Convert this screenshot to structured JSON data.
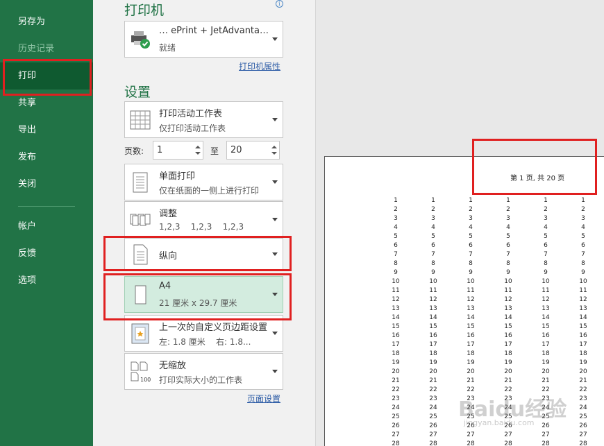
{
  "sidebar": {
    "items": [
      {
        "label": "另存为"
      },
      {
        "label": "历史记录"
      },
      {
        "label": "打印"
      },
      {
        "label": "共享"
      },
      {
        "label": "导出"
      },
      {
        "label": "发布"
      },
      {
        "label": "关闭"
      },
      {
        "label": "帐户"
      },
      {
        "label": "反馈"
      },
      {
        "label": "选项"
      }
    ]
  },
  "printer": {
    "section_title": "打印机",
    "name": "…  ePrint + JetAdvanta…",
    "status": "就绪",
    "properties_link": "打印机属性"
  },
  "settings": {
    "section_title": "设置",
    "print_what": {
      "title": "打印活动工作表",
      "subtitle": "仅打印活动工作表"
    },
    "pages_label": "页数:",
    "page_from": "1",
    "to_label": "至",
    "page_to": "20",
    "sides": {
      "title": "单面打印",
      "subtitle": "仅在纸面的一侧上进行打印"
    },
    "collation": {
      "title": "调整",
      "subtitle": "1,2,3    1,2,3    1,2,3"
    },
    "orientation": {
      "title": "纵向"
    },
    "paper": {
      "title": "A4",
      "subtitle": "21 厘米 x 29.7 厘米"
    },
    "margins": {
      "title": "上一次的自定义页边距设置",
      "subtitle": "左: 1.8 厘米    右: 1.8..."
    },
    "scaling": {
      "title": "无缩放",
      "subtitle": "打印实际大小的工作表"
    },
    "page_setup_link": "页面设置"
  },
  "preview": {
    "page_header": "第 1 页, 共 20 页",
    "column_count": 6,
    "row_values": [
      "1",
      "2",
      "3",
      "4",
      "5",
      "6",
      "7",
      "8",
      "9",
      "10",
      "11",
      "12",
      "13",
      "14",
      "15",
      "16",
      "17",
      "18",
      "19",
      "20",
      "21",
      "22",
      "23",
      "24",
      "25",
      "26",
      "27",
      "28"
    ]
  },
  "watermark": {
    "text": "Baidu经验",
    "url": "jingyan.baidu.com"
  },
  "colors": {
    "sidebar": "#217346",
    "active": "#0f5a30",
    "highlight": "#e02020",
    "selected_bg": "#d3ecdf"
  }
}
